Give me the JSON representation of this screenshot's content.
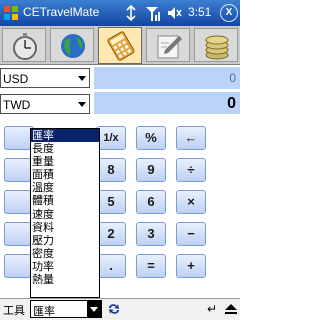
{
  "titlebar": {
    "app_title": "CETravelMate",
    "time": "3:51",
    "close_label": "X"
  },
  "tabs": [
    {
      "name": "stopwatch-tab"
    },
    {
      "name": "world-tab"
    },
    {
      "name": "calculator-tab",
      "active": true
    },
    {
      "name": "notes-tab"
    },
    {
      "name": "money-tab"
    }
  ],
  "converter": {
    "from_unit": "USD",
    "from_value": "0",
    "to_unit": "TWD",
    "to_value": "0"
  },
  "keypad": {
    "keys": [
      "%",
      "←",
      "8",
      "9",
      "÷",
      "5",
      "6",
      "×",
      "2",
      "3",
      "−",
      ".",
      "=",
      "+"
    ],
    "reciprocal": "1/x"
  },
  "dropdown": {
    "items": [
      "匯率",
      "長度",
      "重量",
      "面積",
      "溫度",
      "體積",
      "速度",
      "資料",
      "壓力",
      "密度",
      "功率",
      "熱量"
    ],
    "selected_index": 0
  },
  "bottombar": {
    "tools_label": "工具",
    "combo_value": "匯率"
  },
  "colors": {
    "titlebar": "#1f5bbd",
    "value_box": "#bcd3f8",
    "selection": "#0a246a"
  }
}
